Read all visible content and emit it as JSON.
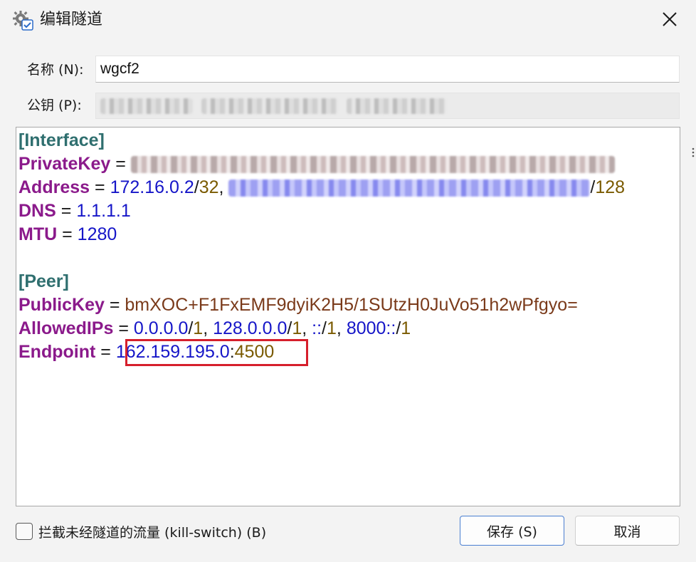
{
  "window": {
    "title": "编辑隧道",
    "icon": "gear-check-icon",
    "close_icon": "close-icon"
  },
  "form": {
    "name_label": "名称 (N):",
    "name_value": "wgcf2",
    "pubkey_label": "公钥 (P):"
  },
  "config": {
    "interface_header": "[Interface]",
    "private_key_key": "PrivateKey",
    "address_key": "Address",
    "address_ip": "172.16.0.2",
    "address_mask": "32",
    "address_v6_mask": "128",
    "dns_key": "DNS",
    "dns_value": "1.1.1.1",
    "mtu_key": "MTU",
    "mtu_value": "1280",
    "peer_header": "[Peer]",
    "public_key_key": "PublicKey",
    "public_key_value": "bmXOC+F1FxEMF9dyiK2H5/1SUtzH0JuVo51h2wPfgyo=",
    "allowed_ips_key": "AllowedIPs",
    "allowed_ips": [
      {
        "ip": "0.0.0.0",
        "mask": "1"
      },
      {
        "ip": "128.0.0.0",
        "mask": "1"
      },
      {
        "ip": "::",
        "mask": "1"
      },
      {
        "ip": "8000::",
        "mask": "1"
      }
    ],
    "endpoint_key": "Endpoint",
    "endpoint_ip": "162.159.195.0",
    "endpoint_port": "4500",
    "equals": "=",
    "slash": "/",
    "comma": ",",
    "colon": ":"
  },
  "footer": {
    "kill_switch_label": "拦截未经隧道的流量 (kill-switch) (B)",
    "kill_switch_checked": false,
    "save_label": "保存 (S)",
    "cancel_label": "取消"
  },
  "colors": {
    "section": "#2f6f6f",
    "key": "#8b1a8b",
    "ip": "#1515c8",
    "number": "#7a5a00",
    "highlight_box": "#d61f2c",
    "save_border": "#4a7fd1"
  }
}
